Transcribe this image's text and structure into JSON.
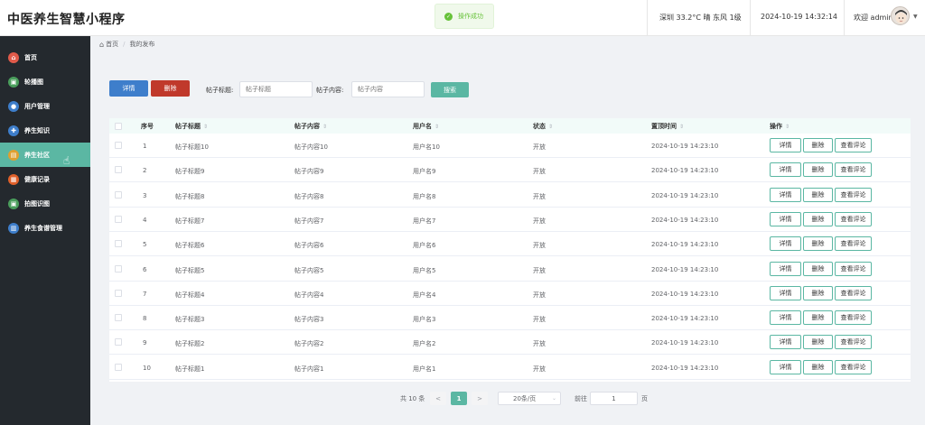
{
  "header": {
    "title": "中医养生智慧小程序",
    "toast": "操作成功",
    "weather": "深圳 33.2°C 晴 东风 1级",
    "datetime": "2024-10-19 14:32:14",
    "welcome": "欢迎 admin"
  },
  "sidebar": {
    "items": [
      {
        "label": "首页",
        "icon": "home-icon",
        "color": "#e05a4a",
        "glyph": "⌂"
      },
      {
        "label": "轮播图",
        "icon": "carousel-icon",
        "color": "#4a9e5c",
        "glyph": "▣"
      },
      {
        "label": "用户管理",
        "icon": "user-icon",
        "color": "#3e7ecb",
        "glyph": "●"
      },
      {
        "label": "养生知识",
        "icon": "knowledge-icon",
        "color": "#3e7ecb",
        "glyph": "✚"
      },
      {
        "label": "养生社区",
        "icon": "community-icon",
        "color": "#e0a030",
        "glyph": "▤"
      },
      {
        "label": "健康记录",
        "icon": "health-record-icon",
        "color": "#e0602a",
        "glyph": "▦"
      },
      {
        "label": "拍图识图",
        "icon": "camera-icon",
        "color": "#4a9e5c",
        "glyph": "▣"
      },
      {
        "label": "养生食谱管理",
        "icon": "recipe-icon",
        "color": "#3e7ecb",
        "glyph": "▥"
      }
    ],
    "active_index": 4
  },
  "breadcrumb": {
    "home": "首页",
    "current": "我的发布"
  },
  "toolbar": {
    "detail_label": "详情",
    "delete_label": "删除",
    "title_label": "帖子标题:",
    "title_placeholder": "帖子标题",
    "content_label": "帖子内容:",
    "content_placeholder": "帖子内容",
    "search_label": "搜索"
  },
  "table": {
    "columns": [
      "序号",
      "帖子标题",
      "帖子内容",
      "用户名",
      "状态",
      "置顶时间",
      "操作"
    ],
    "actions": [
      "详情",
      "删除",
      "查看评论"
    ],
    "rows": [
      {
        "no": "1",
        "title": "帖子标题10",
        "content": "帖子内容10",
        "user": "用户名10",
        "status": "开放",
        "time": "2024-10-19 14:23:10"
      },
      {
        "no": "2",
        "title": "帖子标题9",
        "content": "帖子内容9",
        "user": "用户名9",
        "status": "开放",
        "time": "2024-10-19 14:23:10"
      },
      {
        "no": "3",
        "title": "帖子标题8",
        "content": "帖子内容8",
        "user": "用户名8",
        "status": "开放",
        "time": "2024-10-19 14:23:10"
      },
      {
        "no": "4",
        "title": "帖子标题7",
        "content": "帖子内容7",
        "user": "用户名7",
        "status": "开放",
        "time": "2024-10-19 14:23:10"
      },
      {
        "no": "5",
        "title": "帖子标题6",
        "content": "帖子内容6",
        "user": "用户名6",
        "status": "开放",
        "time": "2024-10-19 14:23:10"
      },
      {
        "no": "6",
        "title": "帖子标题5",
        "content": "帖子内容5",
        "user": "用户名5",
        "status": "开放",
        "time": "2024-10-19 14:23:10"
      },
      {
        "no": "7",
        "title": "帖子标题4",
        "content": "帖子内容4",
        "user": "用户名4",
        "status": "开放",
        "time": "2024-10-19 14:23:10"
      },
      {
        "no": "8",
        "title": "帖子标题3",
        "content": "帖子内容3",
        "user": "用户名3",
        "status": "开放",
        "time": "2024-10-19 14:23:10"
      },
      {
        "no": "9",
        "title": "帖子标题2",
        "content": "帖子内容2",
        "user": "用户名2",
        "status": "开放",
        "time": "2024-10-19 14:23:10"
      },
      {
        "no": "10",
        "title": "帖子标题1",
        "content": "帖子内容1",
        "user": "用户名1",
        "status": "开放",
        "time": "2024-10-19 14:23:10"
      }
    ]
  },
  "pagination": {
    "total": "共 10 条",
    "prev": "<",
    "current": "1",
    "next": ">",
    "page_size": "20条/页",
    "goto_label": "前往",
    "goto_value": "1",
    "unit": "页"
  }
}
